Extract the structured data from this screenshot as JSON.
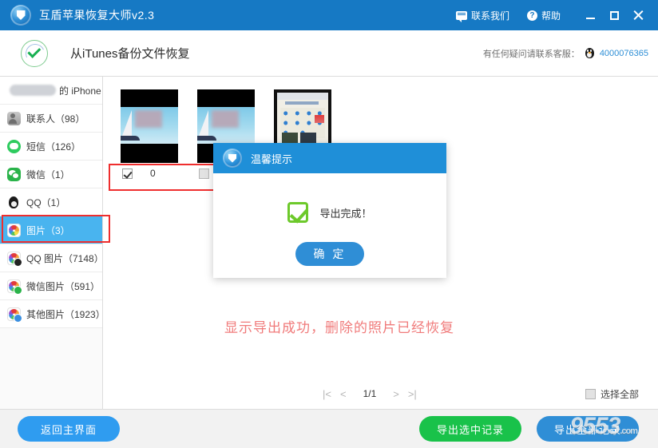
{
  "titlebar": {
    "app_title": "互盾苹果恢复大师v2.3",
    "logo_icon": "shield-logo-icon",
    "contact_label": "联系我们",
    "contact_icon": "chat-bubble-icon",
    "help_label": "帮助",
    "help_icon": "question-circle-icon",
    "minimize_icon": "minimize-icon",
    "maximize_icon": "maximize-icon",
    "close_icon": "close-icon"
  },
  "header": {
    "badge_icon": "green-check-circle-icon",
    "title": "从iTunes备份文件恢复",
    "support_text": "有任何疑问请联系客服：",
    "qq_icon": "qq-penguin-icon",
    "hotline": "4000076365"
  },
  "sidebar": {
    "device_item": {
      "label": "的 iPhone",
      "redacted": true
    },
    "items": [
      {
        "label": "联系人（98）",
        "icon": "contact-icon",
        "active": false
      },
      {
        "label": "短信（126）",
        "icon": "sms-icon",
        "active": false
      },
      {
        "label": "微信（1）",
        "icon": "wechat-icon",
        "active": false
      },
      {
        "label": "QQ（1）",
        "icon": "qq-icon",
        "active": false
      },
      {
        "label": "图片（3）",
        "icon": "photo-icon",
        "active": true
      },
      {
        "label": "QQ 图片（7148）",
        "icon": "qq-photo-icon",
        "active": false
      },
      {
        "label": "微信图片（591）",
        "icon": "wechat-photo-icon",
        "active": false
      },
      {
        "label": "其他图片（1923）",
        "icon": "other-photo-icon",
        "active": false
      }
    ]
  },
  "content": {
    "thumbnails": [
      {
        "name": "thumb-sailboat-1",
        "checked": true,
        "label": "0",
        "kind": "photo"
      },
      {
        "name": "thumb-sailboat-2",
        "checked": false,
        "label": "",
        "kind": "photo"
      },
      {
        "name": "thumb-calendar-3",
        "checked": false,
        "label": "",
        "kind": "calendar"
      }
    ],
    "annotation": "显示导出成功，删除的照片已经恢复",
    "pager": {
      "first_icon": "page-first-icon",
      "prev_icon": "page-prev-icon",
      "page_text": "1/1",
      "next_icon": "page-next-icon",
      "last_icon": "page-last-icon"
    },
    "select_all_label": "选择全部",
    "select_all_checked": false
  },
  "footer": {
    "back_label": "返回主界面",
    "export_selected_label": "导出选中记录",
    "export_all_label": "导出全部记录",
    "watermark": "9553",
    "watermark_tail": ".com"
  },
  "modal": {
    "logo_icon": "shield-logo-icon",
    "title": "温馨提示",
    "success_icon": "green-check-box-icon",
    "message": "导出完成！",
    "ok_label": "确 定"
  },
  "colors": {
    "titlebar_blue": "#1679c4",
    "accent_blue": "#2f8ed6",
    "sidebar_active": "#49b4ef",
    "green_button": "#19c24a",
    "annotation_red": "#ef2e2e",
    "annotation_text_red": "#f07a7a",
    "link_blue": "#2f8fd6"
  }
}
